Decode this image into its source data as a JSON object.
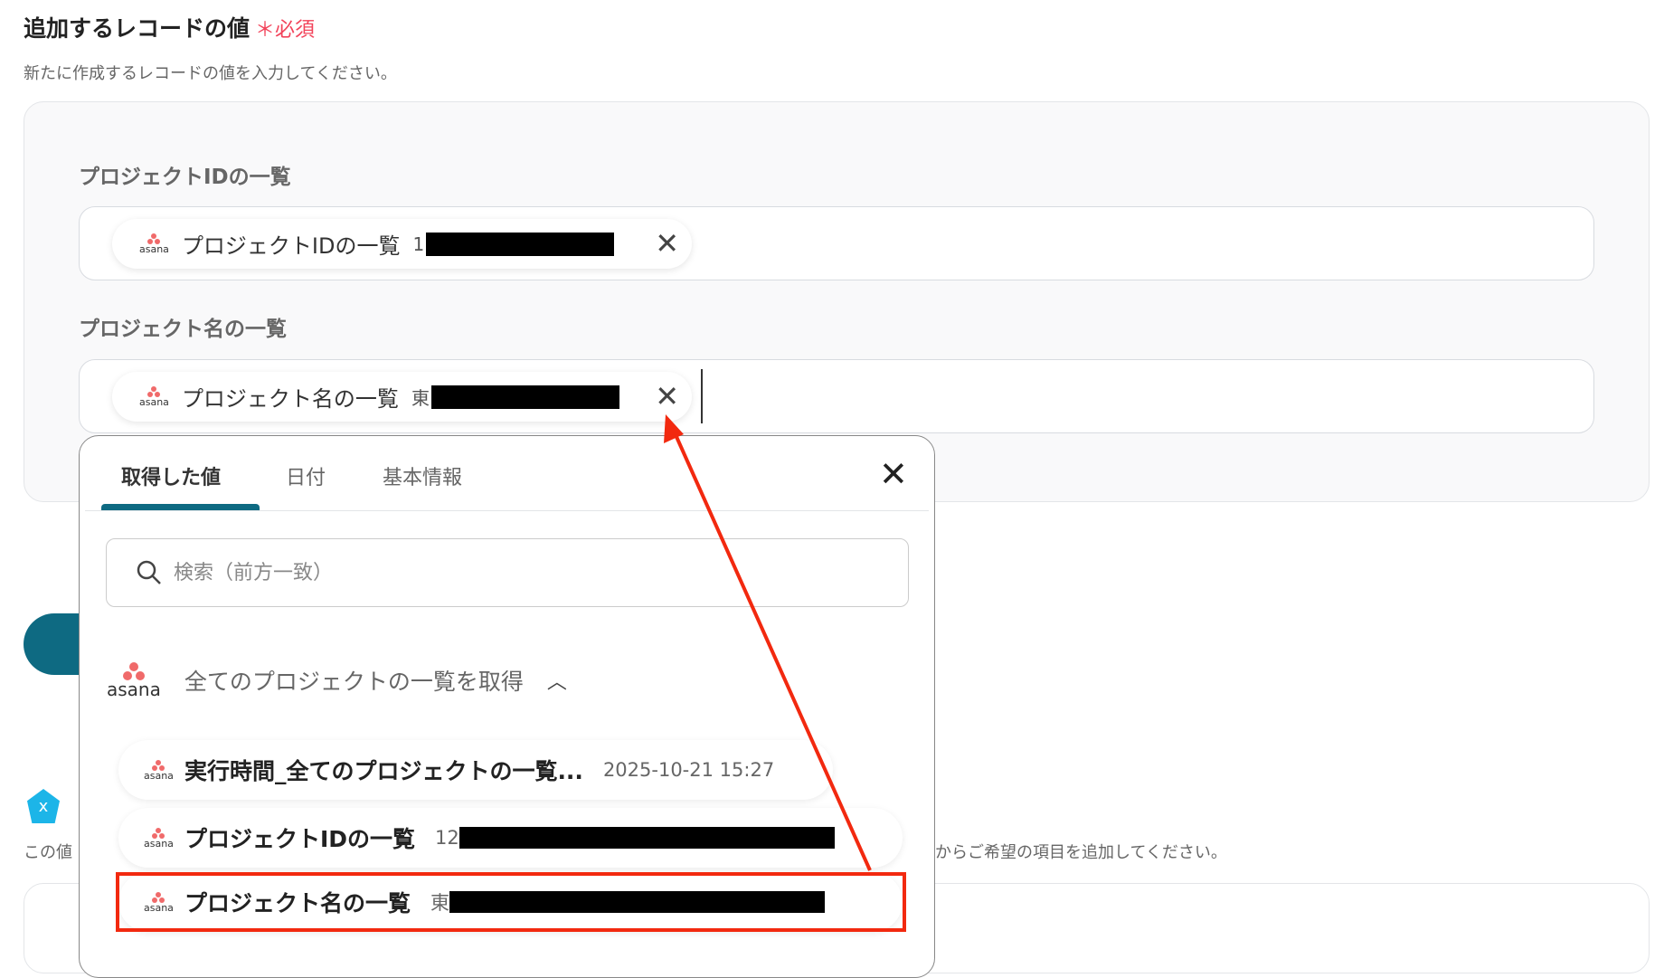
{
  "header": {
    "title": "追加するレコードの値",
    "required_mark": "＊",
    "required_label": "必須",
    "subtitle": "新たに作成するレコードの値を入力してください。"
  },
  "fields": [
    {
      "label": "プロジェクトIDの一覧",
      "chip_label": "プロジェクトIDの一覧",
      "chip_value_prefix": "1",
      "chip_source": "asana"
    },
    {
      "label": "プロジェクト名の一覧",
      "chip_label": "プロジェクト名の一覧",
      "chip_value_prefix": "東",
      "chip_source": "asana"
    }
  ],
  "dropdown": {
    "tabs": [
      {
        "label": "取得した値",
        "active": true
      },
      {
        "label": "日付"
      },
      {
        "label": "基本情報"
      }
    ],
    "search_placeholder": "検索（前方一致）",
    "group": {
      "app": "asana",
      "title": "全てのプロジェクトの一覧を取得",
      "expanded": true
    },
    "items": [
      {
        "name": "実行時間_全てのプロジェクトの一覧...",
        "value": "2025-10-21 15:27"
      },
      {
        "name": "プロジェクトIDの一覧",
        "value": "12"
      },
      {
        "name": "プロジェクト名の一覧",
        "value": "東",
        "highlighted": true
      }
    ]
  },
  "background": {
    "text_left": "この値",
    "text_right": "からご希望の項目を追加してください。"
  },
  "colors": {
    "accent": "#0e6a82",
    "required": "#f2435a",
    "highlight": "#f2290f",
    "asana": "#f06a6a"
  },
  "icons": {
    "asana_logo": "asana",
    "close": "close-icon",
    "search": "search-icon",
    "chevron": "chevron-up-icon"
  }
}
